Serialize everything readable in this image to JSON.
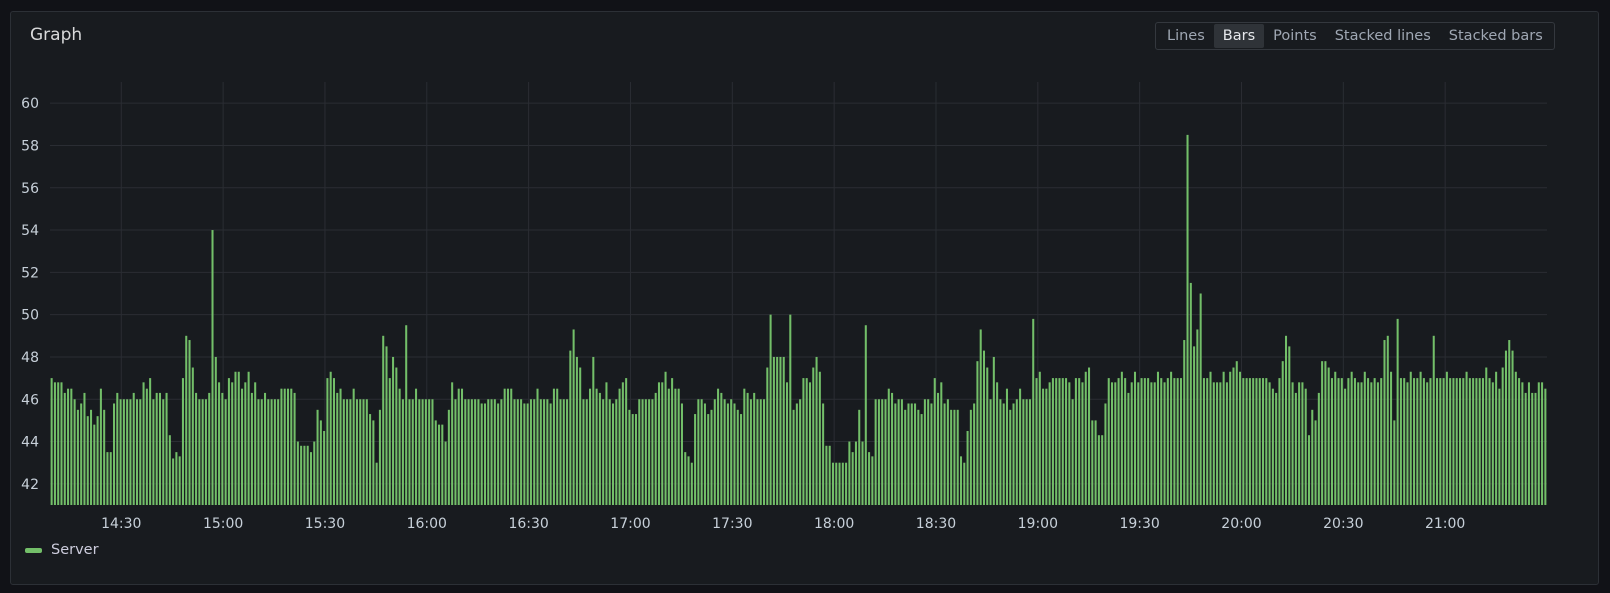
{
  "panel": {
    "title": "Graph",
    "modes": [
      "Lines",
      "Bars",
      "Points",
      "Stacked lines",
      "Stacked bars"
    ],
    "active_mode": "Bars"
  },
  "chart_data": {
    "type": "bar",
    "title": "Graph",
    "xlabel": "",
    "ylabel": "",
    "ylim": [
      41,
      61
    ],
    "y_ticks": [
      42,
      44,
      46,
      48,
      50,
      52,
      54,
      56,
      58,
      60
    ],
    "x_ticks": [
      "14:30",
      "15:00",
      "15:30",
      "16:00",
      "16:30",
      "17:00",
      "17:30",
      "18:00",
      "18:30",
      "19:00",
      "19:30",
      "20:00",
      "20:30",
      "21:00"
    ],
    "x_range": [
      "14:09",
      "21:30"
    ],
    "grid": true,
    "legend_position": "bottom-left",
    "series": [
      {
        "name": "Server",
        "color": "#73bf69",
        "values": [
          47,
          46.8,
          46.8,
          46.8,
          46.3,
          46.5,
          46.5,
          46,
          45.5,
          45.8,
          46.3,
          45.2,
          45.5,
          44.8,
          45.2,
          46.5,
          45.5,
          43.5,
          43.5,
          45.8,
          46.3,
          46,
          46,
          46,
          46,
          46.3,
          46,
          46,
          46.8,
          46.5,
          47,
          46,
          46.3,
          46.3,
          46,
          46.3,
          44.3,
          43.2,
          43.5,
          43.3,
          47,
          49,
          48.8,
          47.5,
          46.3,
          46,
          46,
          46,
          46.3,
          54,
          48,
          46.8,
          46.3,
          46,
          47,
          46.8,
          47.3,
          47.3,
          46.5,
          46.8,
          47.3,
          46.3,
          46.8,
          46,
          46,
          46.3,
          46,
          46,
          46,
          46,
          46.5,
          46.5,
          46.5,
          46.5,
          46.3,
          44,
          43.8,
          43.8,
          43.8,
          43.5,
          44,
          45.5,
          45,
          44.5,
          47,
          47.3,
          47,
          46.3,
          46.5,
          46,
          46,
          46,
          46.5,
          46,
          46,
          46,
          46,
          45.3,
          45,
          43,
          45.5,
          49,
          48.5,
          47,
          48,
          47.5,
          46.5,
          46,
          49.5,
          46,
          46,
          46.5,
          46,
          46,
          46,
          46,
          46,
          45,
          44.8,
          44.8,
          44,
          45.5,
          46.8,
          46,
          46.5,
          46.5,
          46,
          46,
          46,
          46,
          46,
          45.8,
          45.8,
          46,
          46,
          46,
          45.8,
          46,
          46.5,
          46.5,
          46.5,
          46,
          46,
          46,
          45.8,
          45.8,
          46,
          46,
          46.5,
          46,
          46,
          46,
          45.8,
          46.5,
          46.5,
          46,
          46,
          46,
          48.3,
          49.3,
          48,
          47.5,
          46,
          46,
          46.5,
          48,
          46.5,
          46.3,
          46,
          46.8,
          46,
          45.8,
          46,
          46.5,
          46.8,
          47,
          45.5,
          45.3,
          45.3,
          46,
          46,
          46,
          46,
          46,
          46.3,
          46.8,
          46.8,
          47.3,
          46.5,
          47,
          46.5,
          46.5,
          45.8,
          43.5,
          43.3,
          43,
          45.3,
          46,
          46,
          45.8,
          45.3,
          45.5,
          46,
          46.5,
          46.3,
          46,
          45.8,
          46,
          45.8,
          45.5,
          45.3,
          46.5,
          46.3,
          46,
          46.3,
          46,
          46,
          46,
          47.5,
          50,
          48,
          48,
          48,
          48,
          46.8,
          50,
          45.5,
          45.8,
          46,
          47,
          47,
          46.8,
          47.5,
          48,
          47.3,
          45.8,
          43.8,
          43.8,
          43,
          43,
          43,
          43,
          43,
          44,
          43.5,
          44,
          45.5,
          44,
          49.5,
          43.5,
          43.3,
          46,
          46,
          46,
          46,
          46.5,
          46.3,
          45.8,
          46,
          46,
          45.5,
          45.8,
          45.8,
          45.8,
          45.5,
          45.3,
          46,
          46,
          45.8,
          47,
          46.3,
          46.8,
          45.8,
          46,
          45.5,
          45.5,
          45.5,
          43.3,
          43,
          44.5,
          45.5,
          45.8,
          47.8,
          49.3,
          48.3,
          47.5,
          46,
          48,
          46.8,
          46,
          45.8,
          46.5,
          45.5,
          45.8,
          46,
          46.5,
          46,
          46,
          46,
          49.8,
          47,
          47.3,
          46.5,
          46.5,
          46.8,
          47,
          47,
          47,
          47,
          47,
          46.8,
          46,
          47,
          47,
          46.8,
          47.3,
          47.5,
          45,
          45,
          44.3,
          44.3,
          45.8,
          47,
          46.8,
          46.8,
          47,
          47.3,
          47,
          46.3,
          46.8,
          47.3,
          46.8,
          47,
          47,
          47,
          46.8,
          46.8,
          47.3,
          47,
          46.8,
          47,
          47.3,
          47,
          47,
          47,
          48.8,
          58.5,
          51.5,
          48.5,
          49.3,
          51,
          47,
          47,
          47.3,
          46.8,
          46.8,
          46.8,
          47.3,
          46.8,
          47.3,
          47.5,
          47.8,
          47.3,
          47,
          47,
          47,
          47,
          47,
          47,
          47,
          47,
          46.8,
          46.5,
          46.3,
          47,
          47.8,
          49,
          48.5,
          46.8,
          46.3,
          46.8,
          46.8,
          46.5,
          44.3,
          45.5,
          45,
          46.3,
          47.8,
          47.8,
          47.5,
          47,
          47.3,
          47,
          47,
          46.5,
          47,
          47.3,
          47,
          46.8,
          46.8,
          47.3,
          47,
          46.8,
          47,
          46.8,
          47,
          48.8,
          49,
          47.3,
          45,
          49.8,
          47,
          47,
          46.8,
          47.3,
          47,
          47,
          47.3,
          47,
          46.8,
          47,
          49,
          47,
          47,
          47,
          47.3,
          47,
          47,
          47,
          47,
          47,
          47.3,
          47,
          47,
          47,
          47,
          47,
          47.5,
          47,
          46.8,
          47.3,
          46.5,
          47.5,
          48.3,
          48.8,
          48.3,
          47.3,
          47,
          46.8,
          46.3,
          46.8,
          46.3,
          46.3,
          46.8,
          46.8,
          46.5
        ]
      }
    ]
  }
}
